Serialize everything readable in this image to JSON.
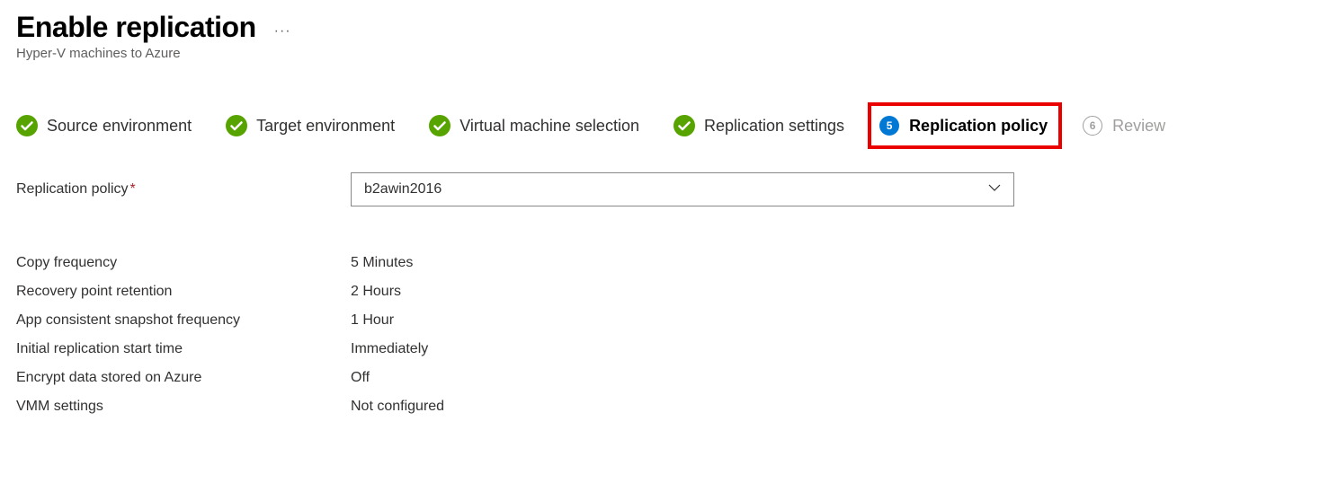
{
  "header": {
    "title": "Enable replication",
    "subtitle": "Hyper-V machines to Azure"
  },
  "steps": [
    {
      "label": "Source environment",
      "state": "complete"
    },
    {
      "label": "Target environment",
      "state": "complete"
    },
    {
      "label": "Virtual machine selection",
      "state": "complete"
    },
    {
      "label": "Replication settings",
      "state": "complete"
    },
    {
      "label": "Replication policy",
      "state": "current",
      "number": "5"
    },
    {
      "label": "Review",
      "state": "upcoming",
      "number": "6"
    }
  ],
  "form": {
    "policy_label": "Replication policy",
    "policy_value": "b2awin2016"
  },
  "settings": [
    {
      "label": "Copy frequency",
      "value": "5 Minutes"
    },
    {
      "label": "Recovery point retention",
      "value": "2 Hours"
    },
    {
      "label": "App consistent snapshot frequency",
      "value": "1 Hour"
    },
    {
      "label": "Initial replication start time",
      "value": "Immediately"
    },
    {
      "label": "Encrypt data stored on Azure",
      "value": "Off"
    },
    {
      "label": "VMM settings",
      "value": "Not configured"
    }
  ]
}
